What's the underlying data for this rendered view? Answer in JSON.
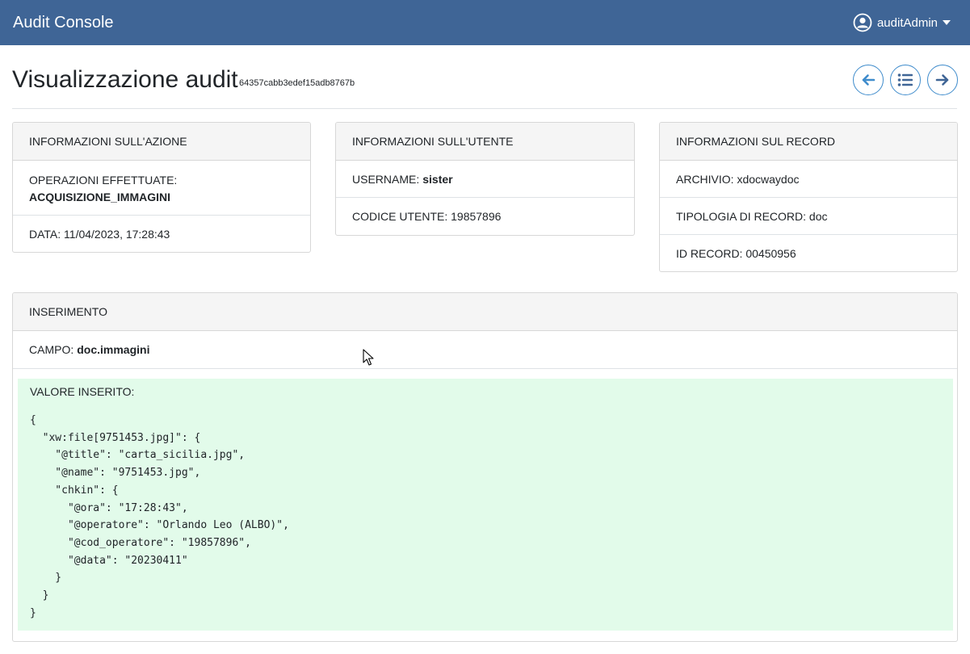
{
  "app": {
    "title": "Audit Console"
  },
  "user": {
    "name": "auditAdmin"
  },
  "header": {
    "title": "Visualizzazione audit",
    "audit_id": "64357cabb3edef15adb8767b"
  },
  "action_card": {
    "title": "INFORMAZIONI SULL'AZIONE",
    "operations_label": "OPERAZIONI EFFETTUATE:",
    "operations_value": "ACQUISIZIONE_IMMAGINI",
    "date_text": "DATA: 11/04/2023, 17:28:43"
  },
  "user_card": {
    "title": "INFORMAZIONI SULL'UTENTE",
    "username_label": "USERNAME:",
    "username_value": "sister",
    "code_text": "CODICE UTENTE: 19857896"
  },
  "record_card": {
    "title": "INFORMAZIONI SUL RECORD",
    "archive_text": "ARCHIVIO: xdocwaydoc",
    "type_text": "TIPOLOGIA DI RECORD: doc",
    "id_text": "ID RECORD: 00450956"
  },
  "insert_card": {
    "title": "INSERIMENTO",
    "field_label": "CAMPO:",
    "field_value": "doc.immagini",
    "value_label": "VALORE INSERITO:",
    "json_text": "{\n  \"xw:file[9751453.jpg]\": {\n    \"@title\": \"carta_sicilia.jpg\",\n    \"@name\": \"9751453.jpg\",\n    \"chkin\": {\n      \"@ora\": \"17:28:43\",\n      \"@operatore\": \"Orlando Leo (ALBO)\",\n      \"@cod_operatore\": \"19857896\",\n      \"@data\": \"20230411\"\n    }\n  }\n}"
  },
  "colors": {
    "navbar": "#3f6596",
    "accent": "#3f8ccc",
    "inserted_background": "#e2fbea"
  },
  "icons": {
    "user": "user-circle-icon",
    "dropdown": "caret-down-icon",
    "previous": "arrow-left-icon",
    "list": "list-icon",
    "next": "arrow-right-icon"
  }
}
